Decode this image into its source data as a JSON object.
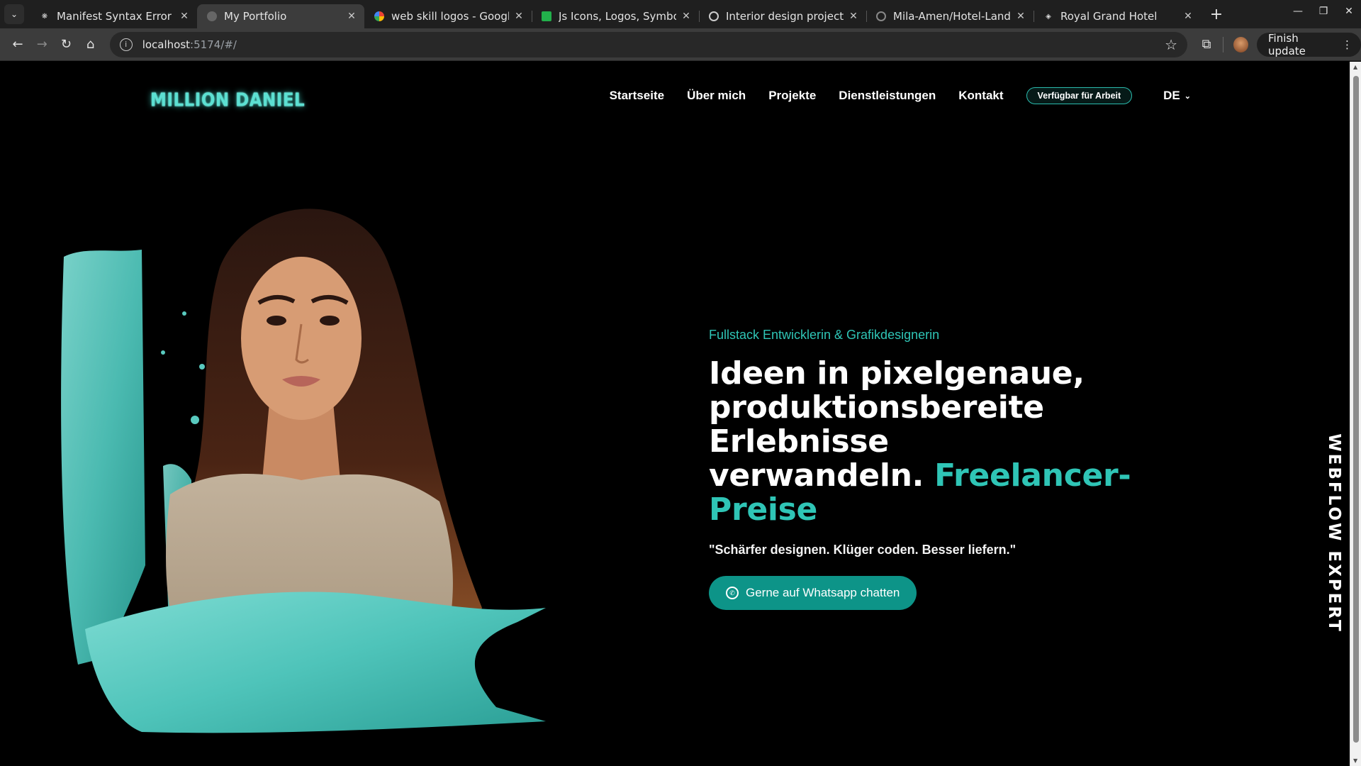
{
  "browser": {
    "tabs": [
      {
        "title": "Manifest Syntax Error Fix",
        "favicon": "openai-icon",
        "active": false
      },
      {
        "title": "My Portfolio",
        "favicon": "globe-icon",
        "active": true
      },
      {
        "title": "web skill logos - Google S",
        "favicon": "google-icon",
        "active": false
      },
      {
        "title": "Js Icons, Logos, Symbole",
        "favicon": "green-square-icon",
        "active": false
      },
      {
        "title": "Interior design projects|",
        "favicon": "circle-icon",
        "active": false
      },
      {
        "title": "Mila-Amen/Hotel-Landin",
        "favicon": "github-icon",
        "active": false
      },
      {
        "title": "Royal Grand Hotel",
        "favicon": "diamond-icon",
        "active": false
      }
    ],
    "url_host": "localhost",
    "url_rest": ":5174/#/",
    "finish_update": "Finish update"
  },
  "site": {
    "logo": "MILLION DANIEL",
    "nav": [
      "Startseite",
      "Über mich",
      "Projekte",
      "Dienstleistungen",
      "Kontakt"
    ],
    "badge": "Verfügbar für Arbeit",
    "lang": "DE",
    "hero": {
      "subtitle": "Fullstack Entwicklerin & Grafikdesignerin",
      "line1": "Ideen in pixelgenaue,",
      "line2": "produktionsbereite Erlebnisse",
      "line3": "verwandeln.",
      "accent": "Freelancer-Preise",
      "quote": "\"Schärfer designen. Klüger coden. Besser liefern.\"",
      "cta": "Gerne auf Whatsapp chatten"
    },
    "vertical_text": "WEBFLOW EXPERT"
  },
  "colors": {
    "accent": "#2fc5b6",
    "button": "#0d9488",
    "background": "#000000"
  }
}
